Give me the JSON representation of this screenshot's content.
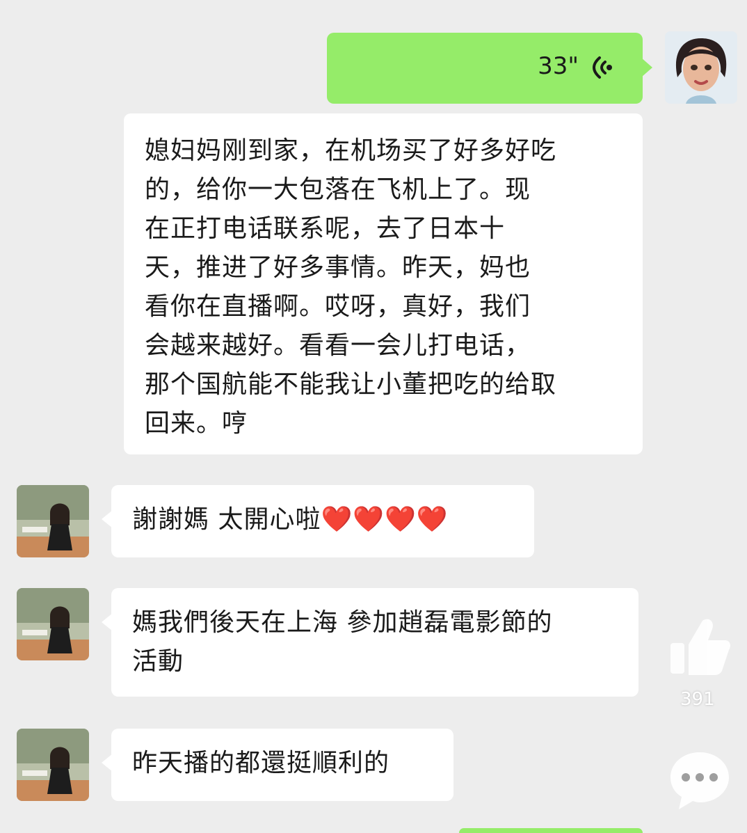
{
  "chat": {
    "messages": [
      {
        "sender": "self",
        "type": "voice",
        "duration": "33\""
      },
      {
        "sender": "self",
        "type": "text",
        "text": "媳妇妈刚到家，在机场买了好多好吃\n的，给你一大包落在飞机上了。现\n在正打电话联系呢，去了日本十\n天，推进了好多事情。昨天，妈也\n看你在直播啊。哎呀，真好，我们\n会越来越好。看看一会儿打电话，\n那个国航能不能我让小董把吃的给取\n回来。哼"
      },
      {
        "sender": "other",
        "type": "text",
        "text": "謝謝媽 太開心啦",
        "emoji": "❤️❤️❤️❤️"
      },
      {
        "sender": "other",
        "type": "text",
        "text": "媽我們後天在上海 參加趙磊電影節的\n活動"
      },
      {
        "sender": "other",
        "type": "text",
        "text": "昨天播的都還挺順利的"
      }
    ]
  },
  "overlay": {
    "like_count": "391",
    "like_icon": "thumbs-up-icon",
    "comment_icon": "comment-bubble-icon"
  },
  "colors": {
    "background": "#ededed",
    "self_bubble": "#95ec69",
    "other_bubble": "#ffffff"
  }
}
